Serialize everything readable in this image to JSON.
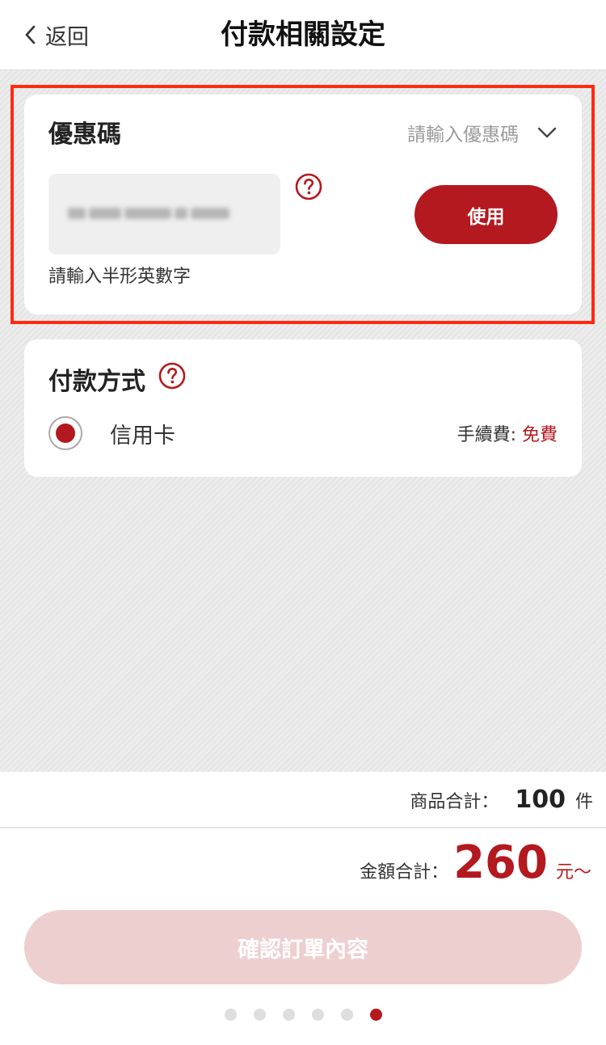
{
  "header": {
    "back_label": "返回",
    "title": "付款相關設定"
  },
  "coupon": {
    "title": "優惠碼",
    "select_placeholder": "請輸入優惠碼",
    "input_value": "",
    "use_button_label": "使用",
    "hint": "請輸入半形英數字"
  },
  "payment": {
    "title": "付款方式",
    "method_label": "信用卡",
    "method_selected": true,
    "fee_label": "手續費: ",
    "fee_value": "免費"
  },
  "summary": {
    "items_label": "商品合計：",
    "items_count": "100",
    "items_unit": "件",
    "amount_label": "金額合計：",
    "amount_value": "260",
    "amount_unit": "元～"
  },
  "confirm_button_label": "確認訂單內容",
  "steps": {
    "total": 6,
    "current": 6
  },
  "colors": {
    "accent": "#b3191f",
    "disabled_button": "#eecfcf",
    "highlight_border": "#ff2a14"
  },
  "icons": {
    "back": "chevron-left-icon",
    "dropdown": "chevron-down-icon",
    "help": "question-circle-icon"
  }
}
